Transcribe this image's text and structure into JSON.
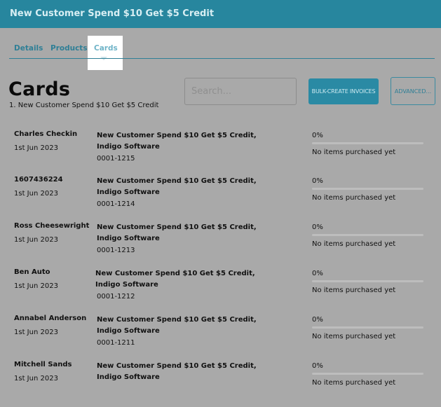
{
  "header": {
    "title": "New Customer Spend $10 Get $5 Credit"
  },
  "tabs": [
    {
      "label": "Details"
    },
    {
      "label": "Products"
    },
    {
      "label": "Cards"
    }
  ],
  "page": {
    "heading": "Cards",
    "subheading": "1. New Customer Spend $10 Get $5 Credit"
  },
  "search": {
    "placeholder": "Search...",
    "value": ""
  },
  "toolbar": {
    "bulk_create_label": "BULK-CREATE INVOICES",
    "advanced_label": "ADVANCED..."
  },
  "cards": [
    {
      "name": "Charles Checkin",
      "date": "1st Jun 2023",
      "product": "New Customer Spend $10 Get $5 Credit, Indigo Software",
      "code": "0001-1215",
      "percent": "0%",
      "progress": 0,
      "status": "No items purchased yet"
    },
    {
      "name": "1607436224",
      "date": "1st Jun 2023",
      "product": "New Customer Spend $10 Get $5 Credit, Indigo Software",
      "code": "0001-1214",
      "percent": "0%",
      "progress": 0,
      "status": "No items purchased yet"
    },
    {
      "name": "Ross Cheesewright",
      "date": "1st Jun 2023",
      "product": "New Customer Spend $10 Get $5 Credit, Indigo Software",
      "code": "0001-1213",
      "percent": "0%",
      "progress": 0,
      "status": "No items purchased yet"
    },
    {
      "name": "Ben Auto",
      "date": "1st Jun 2023",
      "product": "New Customer Spend $10 Get $5 Credit, Indigo Software",
      "code": "0001-1212",
      "percent": "0%",
      "progress": 0,
      "status": "No items purchased yet"
    },
    {
      "name": "Annabel Anderson",
      "date": "1st Jun 2023",
      "product": "New Customer Spend $10 Get $5 Credit, Indigo Software",
      "code": "0001-1211",
      "percent": "0%",
      "progress": 0,
      "status": "No items purchased yet"
    },
    {
      "name": "Mitchell Sands",
      "date": "1st Jun 2023",
      "product": "New Customer Spend $10 Get $5 Credit, Indigo Software",
      "code": "",
      "percent": "0%",
      "progress": 0,
      "status": "No items purchased yet"
    }
  ],
  "colors": {
    "header_bg": "#27869e",
    "accent": "#2a8aa4",
    "overlay_bg": "#a9a9a9"
  }
}
